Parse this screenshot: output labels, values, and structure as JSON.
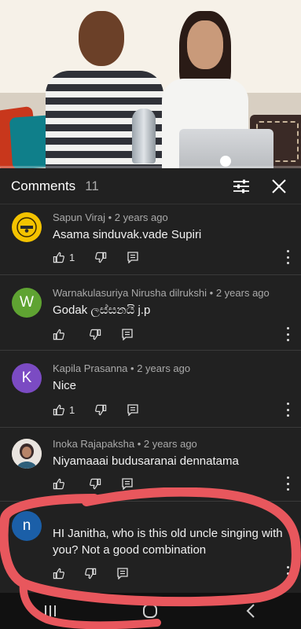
{
  "header": {
    "title": "Comments",
    "count": "11"
  },
  "comments": [
    {
      "author": "Sapun Viraj",
      "time": "2 years ago",
      "text": "Asama sinduvak.vade Supiri",
      "likes": "1",
      "avatar_letter": "",
      "avatar_color": "#f4c300"
    },
    {
      "author": "Warnakulasuriya Nirusha dilrukshi",
      "time": "2 years ago",
      "text": "Godak ලස්සනයි j.p",
      "likes": "",
      "avatar_letter": "W",
      "avatar_color": "#5fa332"
    },
    {
      "author": "Kapila Prasanna",
      "time": "2 years ago",
      "text": "Nice",
      "likes": "1",
      "avatar_letter": "K",
      "avatar_color": "#7b4bc3"
    },
    {
      "author": "Inoka Rajapaksha",
      "time": "2 years ago",
      "text": "Niyamaaai budusaranai dennatama",
      "likes": "",
      "avatar_letter": "",
      "avatar_color": "#c9b6a8"
    },
    {
      "author": "",
      "time": "",
      "text": "HI Janitha, who is this old uncle singing with you? Not a good combination",
      "likes": "",
      "avatar_letter": "n",
      "avatar_color": "#1b5fa8"
    }
  ],
  "colors": {
    "background": "#212121",
    "annotation": "#e8575d"
  },
  "icons": [
    "filter-icon",
    "close-icon",
    "thumb-up-icon",
    "thumb-down-icon",
    "reply-icon",
    "more-icon",
    "recent-apps-icon",
    "home-icon",
    "back-icon"
  ]
}
